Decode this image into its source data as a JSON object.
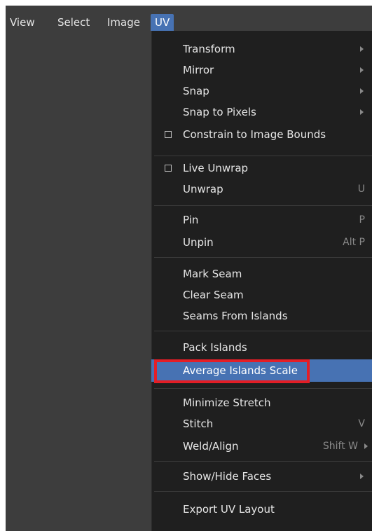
{
  "menubar": {
    "items": [
      "View",
      "Select",
      "Image",
      "UV"
    ],
    "active": "UV"
  },
  "uv_menu": {
    "items": [
      {
        "label": "Transform",
        "submenu": true
      },
      {
        "label": "Mirror",
        "submenu": true
      },
      {
        "label": "Snap",
        "submenu": true
      },
      {
        "label": "Snap to Pixels",
        "submenu": true
      },
      {
        "label": "Constrain to Image Bounds",
        "checkbox": true,
        "checked": false
      },
      {
        "label": "Live Unwrap",
        "checkbox": true,
        "checked": false
      },
      {
        "label": "Unwrap",
        "shortcut": "U"
      },
      {
        "label": "Pin",
        "shortcut": "P"
      },
      {
        "label": "Unpin",
        "shortcut": "Alt P"
      },
      {
        "label": "Mark Seam"
      },
      {
        "label": "Clear Seam"
      },
      {
        "label": "Seams From Islands"
      },
      {
        "label": "Pack Islands"
      },
      {
        "label": "Average Islands Scale",
        "highlighted": true
      },
      {
        "label": "Minimize Stretch"
      },
      {
        "label": "Stitch",
        "shortcut": "V"
      },
      {
        "label": "Weld/Align",
        "shortcut": "Shift W",
        "submenu": true
      },
      {
        "label": "Show/Hide Faces",
        "submenu": true
      },
      {
        "label": "Export UV Layout"
      }
    ]
  },
  "colors": {
    "background": "#3d3d3d",
    "menu_background": "#1f1f1f",
    "accent": "#4772b3",
    "annotation_box": "#e41e26"
  }
}
